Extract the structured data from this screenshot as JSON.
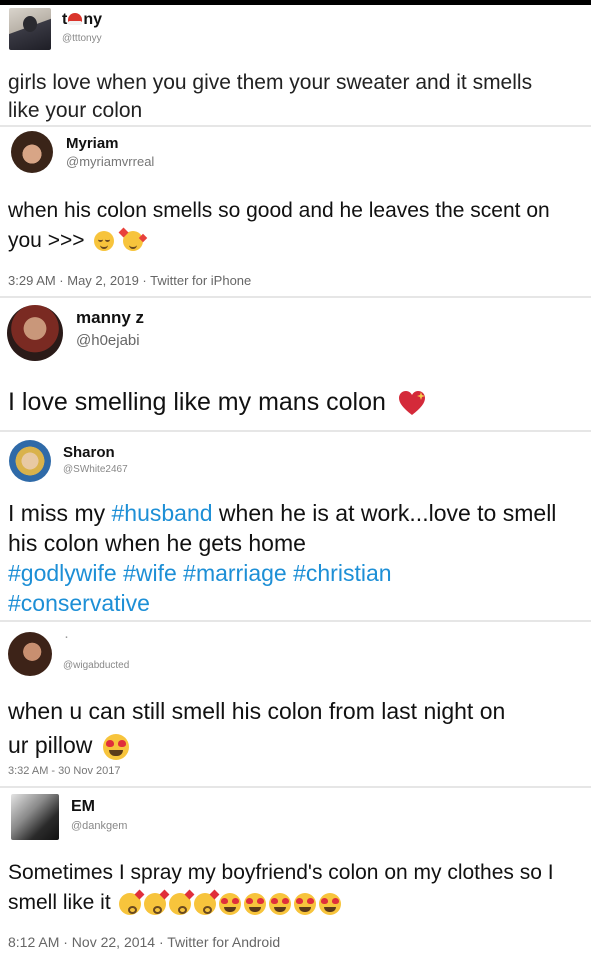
{
  "tweets": [
    {
      "name_prefix": "t",
      "name_suffix": "ny",
      "handle": "@tttonyy",
      "text": "girls love when you give them your sweater and it smells like your colon"
    },
    {
      "name": "Myriam",
      "handle": "@myriamvrreal",
      "text": "when his colon smells so good and he leaves the scent on you >>>",
      "emojis": [
        "relieved-face-emoji",
        "smiling-face-with-hearts-emoji"
      ],
      "meta": "3:29 AM · May 2, 2019 · Twitter for iPhone"
    },
    {
      "name": "manny z",
      "handle": "@h0ejabi",
      "text": "I love smelling like my mans colon",
      "emojis": [
        "sparkling-heart-emoji"
      ]
    },
    {
      "name": "Sharon",
      "handle": "@SWhite2467",
      "text_a": "I miss my ",
      "hashtag_1": "#husband",
      "text_b": " when he is at work...love to smell his colon when he gets home",
      "hashtags_line": "#godlywife #wife #marriage #christian",
      "hashtag_last": "#conservative"
    },
    {
      "name": "·",
      "handle": "@wigabducted",
      "text": "when u can still smell his colon from last night on ur pillow",
      "emojis": [
        "heart-eyes-emoji"
      ],
      "meta": "3:32 AM - 30 Nov 2017"
    },
    {
      "name": "EM",
      "handle": "@dankgem",
      "text": "Sometimes I spray my boyfriend's colon on my clothes so I smell like it",
      "emojis": [
        "kissing-face-emoji",
        "kissing-face-emoji",
        "kissing-face-emoji",
        "kissing-face-emoji",
        "heart-eyes-emoji",
        "heart-eyes-emoji",
        "heart-eyes-emoji",
        "heart-eyes-emoji",
        "heart-eyes-emoji"
      ],
      "meta": "8:12 AM · Nov 22, 2014 · Twitter for Android"
    }
  ],
  "colors": {
    "hashtag": "#1d8fd6",
    "handle": "#777777",
    "meta": "#666666"
  }
}
